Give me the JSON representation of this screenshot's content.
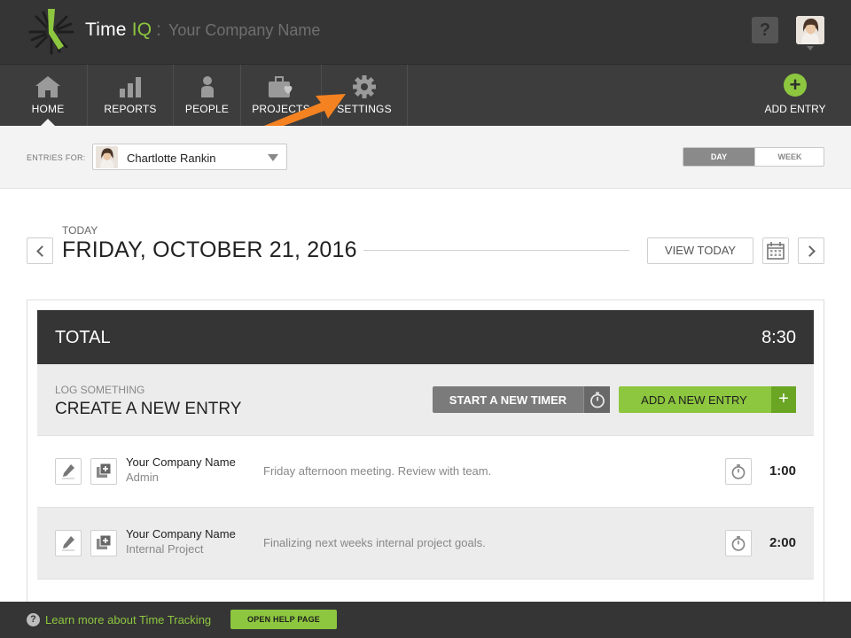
{
  "app": {
    "brand_name": "Time",
    "brand_accent": "IQ",
    "separator": ":",
    "company_placeholder": "Your Company Name",
    "help_label": "?"
  },
  "colors": {
    "accent": "#8dc63f",
    "topbar": "#353535",
    "annotation_arrow": "#f58220"
  },
  "nav": {
    "items": [
      {
        "label": "HOME",
        "icon": "home-icon",
        "active": true
      },
      {
        "label": "REPORTS",
        "icon": "bar-chart-icon"
      },
      {
        "label": "PEOPLE",
        "icon": "person-icon"
      },
      {
        "label": "PROJECTS",
        "icon": "briefcase-heart-icon"
      },
      {
        "label": "SETTINGS",
        "icon": "gear-icon"
      }
    ],
    "add_entry": {
      "label": "ADD ENTRY",
      "icon": "plus-circle-icon"
    }
  },
  "filter": {
    "entries_for_label": "ENTRIES FOR:",
    "selected_user": "Chartlotte Rankin",
    "view_toggle": {
      "day": "DAY",
      "week": "WEEK",
      "selected": "DAY"
    }
  },
  "date_header": {
    "today_label": "TODAY",
    "date": "FRIDAY, OCTOBER 21, 2016",
    "view_today": "VIEW TODAY"
  },
  "summary": {
    "total_label": "TOTAL",
    "total_value": "8:30",
    "log_small": "LOG SOMETHING",
    "log_big": "CREATE A NEW ENTRY",
    "start_timer": "START A NEW TIMER",
    "add_new_entry": "ADD A NEW ENTRY"
  },
  "entries": [
    {
      "project": "Your Company Name",
      "task": "Admin",
      "description": "Friday afternoon meeting. Review with team.",
      "duration": "1:00"
    },
    {
      "project": "Your Company Name",
      "task": "Internal Project",
      "description": "Finalizing next weeks internal project goals.",
      "duration": "2:00"
    }
  ],
  "footer": {
    "learn_more": "Learn more about Time Tracking",
    "open_help": "OPEN HELP PAGE",
    "help_icon": "?"
  }
}
